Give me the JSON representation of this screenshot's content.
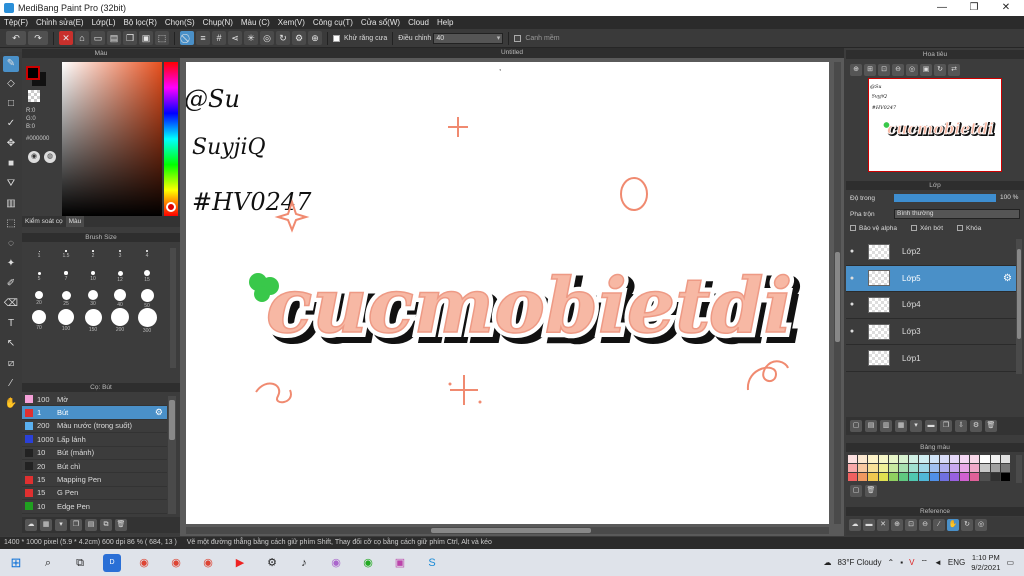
{
  "app": {
    "title": "MediBang Paint Pro (32bit)",
    "window_controls": [
      "—",
      "❐",
      "✕"
    ]
  },
  "menu": [
    "Tệp(F)",
    "Chỉnh sửa(E)",
    "Lớp(L)",
    "Bộ lọc(R)",
    "Chọn(S)",
    "Chụp(N)",
    "Màu (C)",
    "Xem(V)",
    "Công cụ(T)",
    "Cửa sổ(W)",
    "Cloud",
    "Help"
  ],
  "toolbar": {
    "antialias_label": "Khử răng cưa",
    "correction_label": "Điều chỉnh",
    "correction_value": "40",
    "smooth_label": "Canh mềm"
  },
  "panels": {
    "color": "Màu",
    "brush_size": "Brush Size",
    "brush": "Cọ: Bút",
    "canvas": "Untitled",
    "navigator": "Hoa tiêu",
    "layer": "Lớp",
    "palette": "Bảng màu",
    "reference": "Reference"
  },
  "color": {
    "r": "R:0",
    "g": "G:0",
    "b": "B:0",
    "hex": "#000000",
    "tabs": [
      "Kiểm soát cọ",
      "Màu"
    ]
  },
  "brush_sizes": [
    "1",
    "1.5",
    "2",
    "3",
    "4",
    "5",
    "7",
    "10",
    "12",
    "15",
    "20",
    "25",
    "30",
    "40",
    "50",
    "70",
    "100",
    "150",
    "200",
    "300"
  ],
  "brushes": [
    {
      "size": "100",
      "name": "Mờ",
      "color": "#f5a0d8"
    },
    {
      "size": "1",
      "name": "Bút",
      "color": "#e03030",
      "selected": true
    },
    {
      "size": "200",
      "name": "Màu nước (trong suốt)",
      "color": "#5ab0f0"
    },
    {
      "size": "1000",
      "name": "Lấp lánh",
      "color": "#2a40d8"
    },
    {
      "size": "10",
      "name": "Bút (mảnh)",
      "color": "#222222"
    },
    {
      "size": "20",
      "name": "Bút chì",
      "color": "#222222"
    },
    {
      "size": "15",
      "name": "Mapping Pen",
      "color": "#e03030"
    },
    {
      "size": "15",
      "name": "G Pen",
      "color": "#e03030"
    },
    {
      "size": "10",
      "name": "Edge Pen",
      "color": "#20a020"
    }
  ],
  "artwork": {
    "handle": "@Su",
    "name": "SuyjiQ",
    "tag": "#HV0247",
    "logo": "cucmobietdi"
  },
  "layer_props": {
    "opacity_label": "Độ trong",
    "opacity_value": "100 %",
    "opacity": 1.0,
    "blend_label": "Pha trộn",
    "blend_value": "Bình thường",
    "protect_alpha": "Bảo vệ alpha",
    "clipping": "Xén bớt",
    "lock": "Khóa"
  },
  "layers": [
    {
      "name": "Lớp2",
      "visible": true
    },
    {
      "name": "Lớp5",
      "visible": true,
      "selected": true
    },
    {
      "name": "Lớp4",
      "visible": true
    },
    {
      "name": "Lớp3",
      "visible": true
    },
    {
      "name": "Lớp1",
      "visible": false
    }
  ],
  "palette_colors": [
    "#fde0e0",
    "#fce8d0",
    "#fdf3c8",
    "#f7f7c8",
    "#e8f5c8",
    "#d8f2d0",
    "#d0f0e4",
    "#d0eef2",
    "#d0e4f8",
    "#d8dcf8",
    "#e4d8f8",
    "#f4d8f4",
    "#f8d8e8",
    "#ffffff",
    "#f0f0f0",
    "#e0e0e0",
    "#f8a8a8",
    "#f8c8a0",
    "#f8e098",
    "#f0f098",
    "#c8e8a0",
    "#a8e0b0",
    "#a0e0d0",
    "#a0d8e8",
    "#a0c0f0",
    "#b0b0f0",
    "#c8a8f0",
    "#e8a8e8",
    "#f0a8c8",
    "#c8c8c8",
    "#a0a0a0",
    "#787878",
    "#f06060",
    "#f09860",
    "#f0c850",
    "#e0e050",
    "#90d060",
    "#60c880",
    "#50c8b0",
    "#50b8d8",
    "#5090e8",
    "#7070e0",
    "#9860e0",
    "#d060d0",
    "#e06098",
    "#505050",
    "#303030",
    "#000000"
  ],
  "status": {
    "canvas_info": "1400 * 1000 pixel   (5.9 * 4.2cm)  600 dpi   86 %   ( 684, 13 )",
    "hint": "Vẽ một đường thẳng bằng cách giữ phím Shift, Thay đổi cỡ cọ bằng cách giữ phím Ctrl, Alt và kéo"
  },
  "taskbar": {
    "weather": "83°F Cloudy",
    "lang": "ENG",
    "time": "1:10 PM",
    "date": "9/2/2021"
  }
}
